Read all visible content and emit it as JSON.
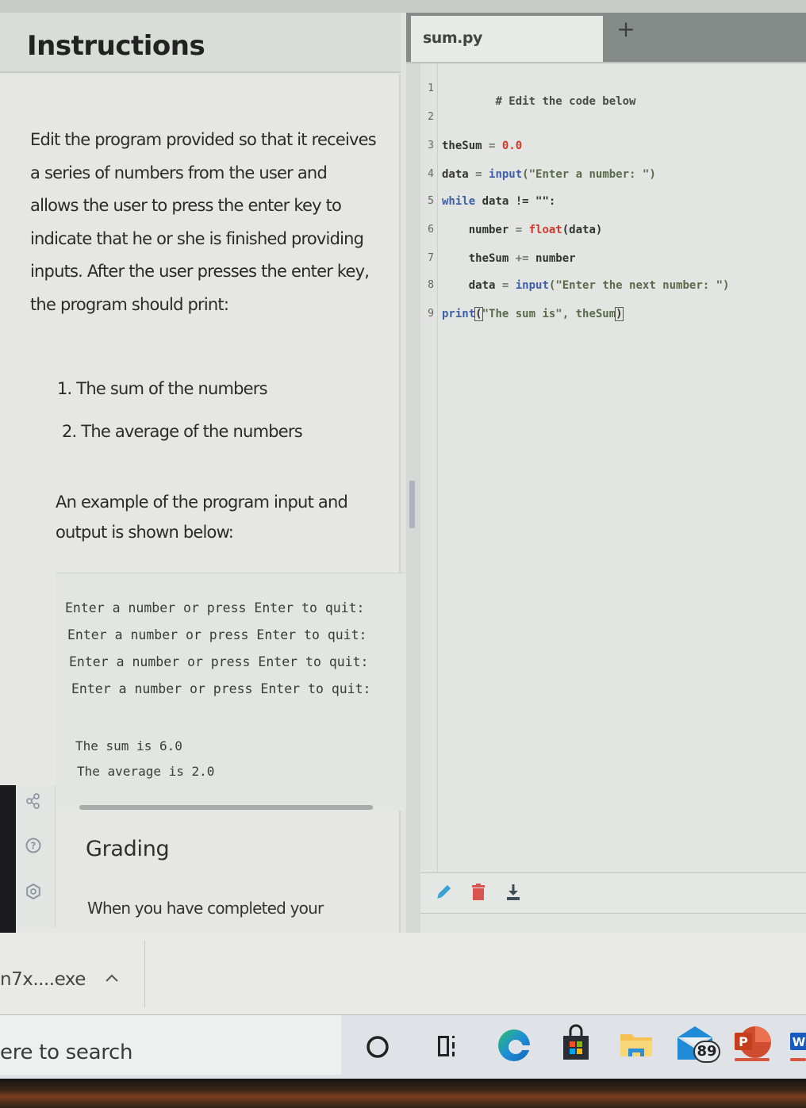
{
  "instructions": {
    "title": "Instructions",
    "paragraph": "Edit the program provided so that it receives a series of numbers from the user and allows the user to press the enter key to indicate that he or she is finished providing inputs. After the user presses the enter key, the program should print:",
    "list": [
      "1. The sum of the numbers",
      "2. The average of the numbers"
    ],
    "example_intro": "An example of the program input and output is shown below:",
    "example_console": [
      "Enter a number or press Enter to quit:",
      "Enter a number or press Enter to quit:",
      "Enter a number or press Enter to quit:",
      "Enter a number or press Enter to quit:",
      "The sum is 6.0",
      "The average is 2.0"
    ],
    "grading_title": "Grading",
    "grading_text": "When you have completed your"
  },
  "sidebar_icons": [
    "share-icon",
    "help-icon",
    "settings-icon"
  ],
  "editor": {
    "tab_label": "sum.py",
    "add_tab_label": "+",
    "line_numbers": [
      "1",
      "2",
      "3",
      "4",
      "5",
      "6",
      "7",
      "8",
      "9"
    ],
    "code": {
      "l1_comment": "# Edit the code below",
      "l3_var": "theSum",
      "l3_op": " = ",
      "l3_num": "0.0",
      "l4_var": "data",
      "l4_op": " = ",
      "l4_fn": "input",
      "l4_str": "(\"Enter a number: \")",
      "l5_kw": "while",
      "l5_rest": " data != \"\":",
      "l6_indent": "    ",
      "l6_var": "number",
      "l6_op": " = ",
      "l6_builtin": "float",
      "l6_rest": "(data)",
      "l7_indent": "    ",
      "l7_var": "theSum",
      "l7_op": " += ",
      "l7_rest": "number",
      "l8_indent": "    ",
      "l8_var": "data",
      "l8_op": " = ",
      "l8_fn": "input",
      "l8_str": "(\"Enter the next number: \")",
      "l9_fn": "print",
      "l9_open": "(",
      "l9_str": "\"The sum is\", theSum",
      "l9_close": ")"
    },
    "footer_icons": [
      "pencil-icon",
      "trash-icon",
      "download-icon"
    ]
  },
  "download_bar": {
    "file_name": "n7x....exe"
  },
  "taskbar": {
    "search_placeholder": "ere to search",
    "mail_badge": "89",
    "apps": [
      "cortana",
      "task-view",
      "edge",
      "microsoft-store",
      "file-explorer",
      "mail",
      "powerpoint",
      "word"
    ]
  },
  "colors": {
    "keyword": "#3e5ea8",
    "number": "#d0392b",
    "trash": "#d9534f",
    "pencil": "#3aa3d6"
  }
}
